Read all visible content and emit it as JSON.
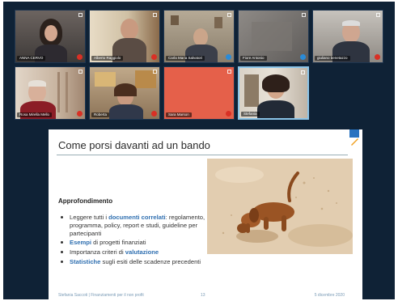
{
  "participants": [
    {
      "name": "ANNA CERVO"
    },
    {
      "name": "Alberto Raggiolo"
    },
    {
      "name": "Carla Maria Salvatori"
    },
    {
      "name": "Fiore Antonio"
    },
    {
      "name": "giuliano benetazzo"
    },
    {
      "name": "Rosa Mirella Mello"
    },
    {
      "name": "Roberta"
    },
    {
      "name": "Sara Marson"
    },
    {
      "name": "Stefania"
    }
  ],
  "slide": {
    "title": "Come porsi davanti ad un bando",
    "section_heading": "Approfondimento",
    "bullets": [
      {
        "pre": "Leggere tutti i ",
        "hl": "documenti correlati",
        "post": ": regolamento, programma, policy, report e studi, guideline per partecipanti"
      },
      {
        "pre": "",
        "hl": "Esempi",
        "post": " di progetti finanziati"
      },
      {
        "pre": "Importanza criteri di ",
        "hl": "valutazione",
        "post": ""
      },
      {
        "pre": "",
        "hl": "Statistiche",
        "post": " sugli esiti delle scadenze precedenti"
      }
    ],
    "footer_left": "Stefania Saccoti | Finanziamenti per il non profit",
    "footer_mid": "13",
    "footer_right": "5 dicembre 2020"
  },
  "colors": {
    "call_background": "#0f2236",
    "highlight": "#2f6fb0",
    "mic_muted": "#d93025"
  }
}
